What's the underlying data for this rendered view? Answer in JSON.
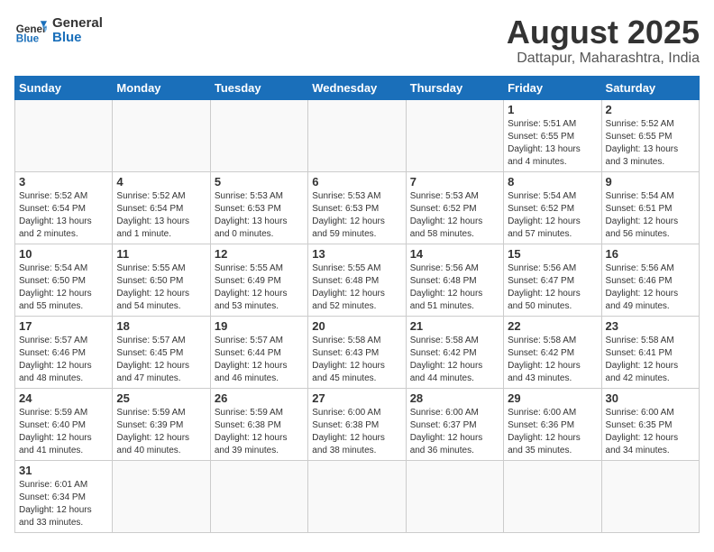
{
  "header": {
    "logo_general": "General",
    "logo_blue": "Blue",
    "month_title": "August 2025",
    "location": "Dattapur, Maharashtra, India"
  },
  "days_of_week": [
    "Sunday",
    "Monday",
    "Tuesday",
    "Wednesday",
    "Thursday",
    "Friday",
    "Saturday"
  ],
  "weeks": [
    [
      {
        "day": "",
        "info": ""
      },
      {
        "day": "",
        "info": ""
      },
      {
        "day": "",
        "info": ""
      },
      {
        "day": "",
        "info": ""
      },
      {
        "day": "",
        "info": ""
      },
      {
        "day": "1",
        "info": "Sunrise: 5:51 AM\nSunset: 6:55 PM\nDaylight: 13 hours\nand 4 minutes."
      },
      {
        "day": "2",
        "info": "Sunrise: 5:52 AM\nSunset: 6:55 PM\nDaylight: 13 hours\nand 3 minutes."
      }
    ],
    [
      {
        "day": "3",
        "info": "Sunrise: 5:52 AM\nSunset: 6:54 PM\nDaylight: 13 hours\nand 2 minutes."
      },
      {
        "day": "4",
        "info": "Sunrise: 5:52 AM\nSunset: 6:54 PM\nDaylight: 13 hours\nand 1 minute."
      },
      {
        "day": "5",
        "info": "Sunrise: 5:53 AM\nSunset: 6:53 PM\nDaylight: 13 hours\nand 0 minutes."
      },
      {
        "day": "6",
        "info": "Sunrise: 5:53 AM\nSunset: 6:53 PM\nDaylight: 12 hours\nand 59 minutes."
      },
      {
        "day": "7",
        "info": "Sunrise: 5:53 AM\nSunset: 6:52 PM\nDaylight: 12 hours\nand 58 minutes."
      },
      {
        "day": "8",
        "info": "Sunrise: 5:54 AM\nSunset: 6:52 PM\nDaylight: 12 hours\nand 57 minutes."
      },
      {
        "day": "9",
        "info": "Sunrise: 5:54 AM\nSunset: 6:51 PM\nDaylight: 12 hours\nand 56 minutes."
      }
    ],
    [
      {
        "day": "10",
        "info": "Sunrise: 5:54 AM\nSunset: 6:50 PM\nDaylight: 12 hours\nand 55 minutes."
      },
      {
        "day": "11",
        "info": "Sunrise: 5:55 AM\nSunset: 6:50 PM\nDaylight: 12 hours\nand 54 minutes."
      },
      {
        "day": "12",
        "info": "Sunrise: 5:55 AM\nSunset: 6:49 PM\nDaylight: 12 hours\nand 53 minutes."
      },
      {
        "day": "13",
        "info": "Sunrise: 5:55 AM\nSunset: 6:48 PM\nDaylight: 12 hours\nand 52 minutes."
      },
      {
        "day": "14",
        "info": "Sunrise: 5:56 AM\nSunset: 6:48 PM\nDaylight: 12 hours\nand 51 minutes."
      },
      {
        "day": "15",
        "info": "Sunrise: 5:56 AM\nSunset: 6:47 PM\nDaylight: 12 hours\nand 50 minutes."
      },
      {
        "day": "16",
        "info": "Sunrise: 5:56 AM\nSunset: 6:46 PM\nDaylight: 12 hours\nand 49 minutes."
      }
    ],
    [
      {
        "day": "17",
        "info": "Sunrise: 5:57 AM\nSunset: 6:46 PM\nDaylight: 12 hours\nand 48 minutes."
      },
      {
        "day": "18",
        "info": "Sunrise: 5:57 AM\nSunset: 6:45 PM\nDaylight: 12 hours\nand 47 minutes."
      },
      {
        "day": "19",
        "info": "Sunrise: 5:57 AM\nSunset: 6:44 PM\nDaylight: 12 hours\nand 46 minutes."
      },
      {
        "day": "20",
        "info": "Sunrise: 5:58 AM\nSunset: 6:43 PM\nDaylight: 12 hours\nand 45 minutes."
      },
      {
        "day": "21",
        "info": "Sunrise: 5:58 AM\nSunset: 6:42 PM\nDaylight: 12 hours\nand 44 minutes."
      },
      {
        "day": "22",
        "info": "Sunrise: 5:58 AM\nSunset: 6:42 PM\nDaylight: 12 hours\nand 43 minutes."
      },
      {
        "day": "23",
        "info": "Sunrise: 5:58 AM\nSunset: 6:41 PM\nDaylight: 12 hours\nand 42 minutes."
      }
    ],
    [
      {
        "day": "24",
        "info": "Sunrise: 5:59 AM\nSunset: 6:40 PM\nDaylight: 12 hours\nand 41 minutes."
      },
      {
        "day": "25",
        "info": "Sunrise: 5:59 AM\nSunset: 6:39 PM\nDaylight: 12 hours\nand 40 minutes."
      },
      {
        "day": "26",
        "info": "Sunrise: 5:59 AM\nSunset: 6:38 PM\nDaylight: 12 hours\nand 39 minutes."
      },
      {
        "day": "27",
        "info": "Sunrise: 6:00 AM\nSunset: 6:38 PM\nDaylight: 12 hours\nand 38 minutes."
      },
      {
        "day": "28",
        "info": "Sunrise: 6:00 AM\nSunset: 6:37 PM\nDaylight: 12 hours\nand 36 minutes."
      },
      {
        "day": "29",
        "info": "Sunrise: 6:00 AM\nSunset: 6:36 PM\nDaylight: 12 hours\nand 35 minutes."
      },
      {
        "day": "30",
        "info": "Sunrise: 6:00 AM\nSunset: 6:35 PM\nDaylight: 12 hours\nand 34 minutes."
      }
    ],
    [
      {
        "day": "31",
        "info": "Sunrise: 6:01 AM\nSunset: 6:34 PM\nDaylight: 12 hours\nand 33 minutes."
      },
      {
        "day": "",
        "info": ""
      },
      {
        "day": "",
        "info": ""
      },
      {
        "day": "",
        "info": ""
      },
      {
        "day": "",
        "info": ""
      },
      {
        "day": "",
        "info": ""
      },
      {
        "day": "",
        "info": ""
      }
    ]
  ]
}
